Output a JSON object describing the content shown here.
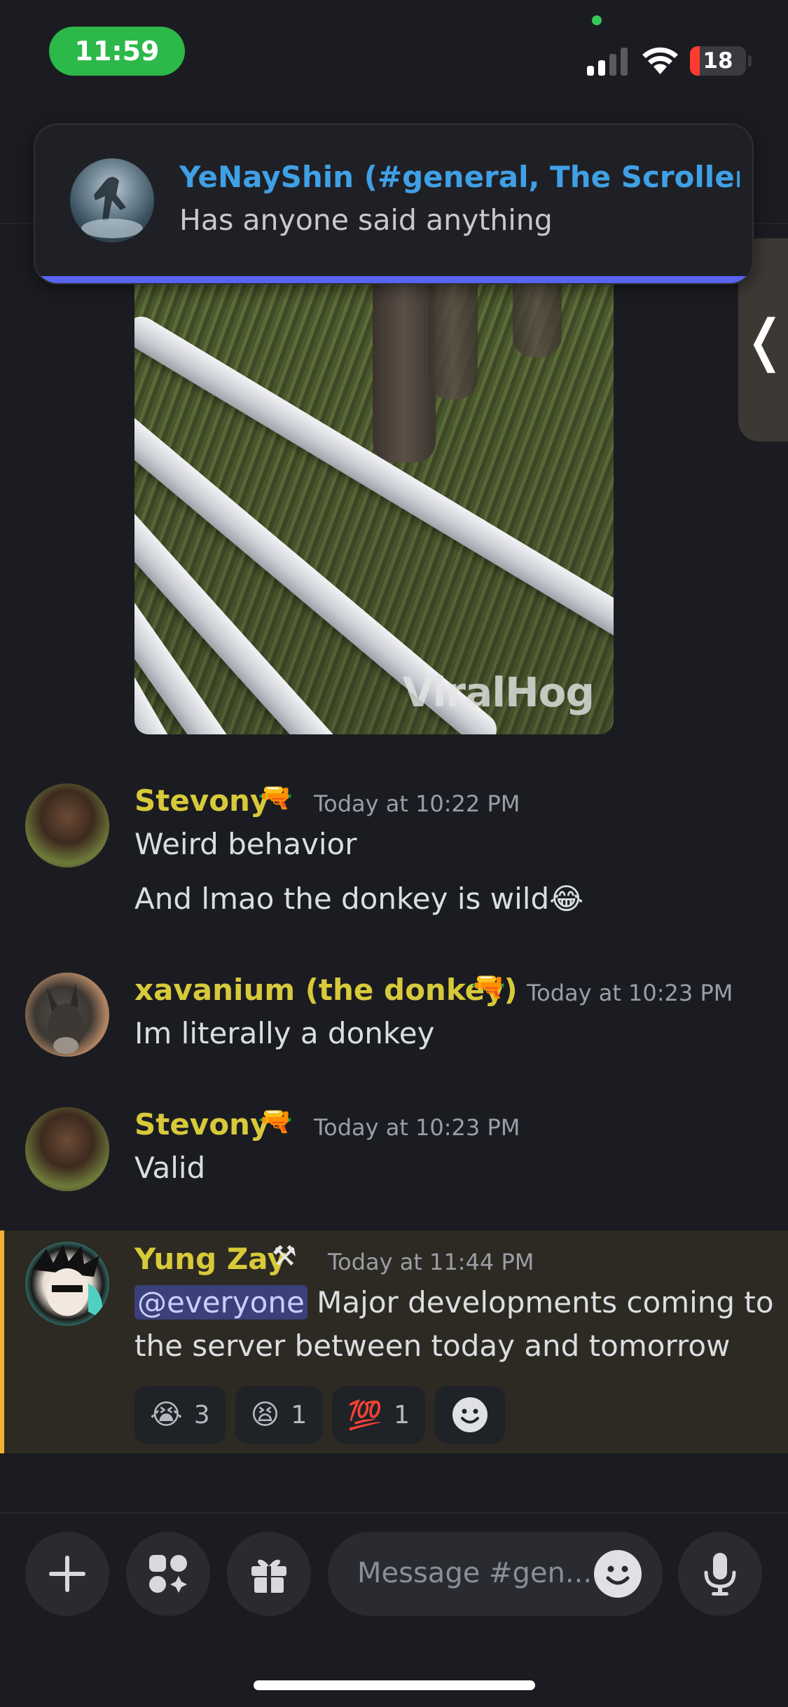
{
  "status_bar": {
    "time": "11:59",
    "battery": "18"
  },
  "notification": {
    "title": "YeNayShin (#general, The Scroller...",
    "body": "Has anyone said anything"
  },
  "video": {
    "watermark": "ViralHog"
  },
  "messages": [
    {
      "author": "Stevony",
      "badge": "🔫",
      "timestamp": "Today at 10:22 PM",
      "lines": [
        "Weird behavior",
        "And lmao the donkey is wild😂"
      ]
    },
    {
      "author": "xavanium (the donkey)",
      "badge": "🔫",
      "timestamp": "Today at 10:23 PM",
      "lines": [
        "Im literally a donkey"
      ]
    },
    {
      "author": "Stevony",
      "badge": "🔫",
      "timestamp": "Today at 10:23 PM",
      "lines": [
        "Valid"
      ]
    },
    {
      "author": "Yung Zay",
      "badge": "⚒",
      "timestamp": "Today at 11:44 PM",
      "mention": "@everyone",
      "line1_rest": " Major developments coming to",
      "line2": "the server between today and tomorrow",
      "reactions": [
        {
          "emoji": "😭",
          "count": "3"
        },
        {
          "emoji": "😫",
          "count": "1"
        },
        {
          "emoji": "💯",
          "count": "1"
        }
      ]
    }
  ],
  "composer": {
    "placeholder": "Message #gen..."
  },
  "colors": {
    "background": "#1b1c21",
    "username": "#d8c93a",
    "notification_title": "#3fa0e6",
    "accent_bar": "#5865f2",
    "highlight_edge": "#f0b232"
  }
}
